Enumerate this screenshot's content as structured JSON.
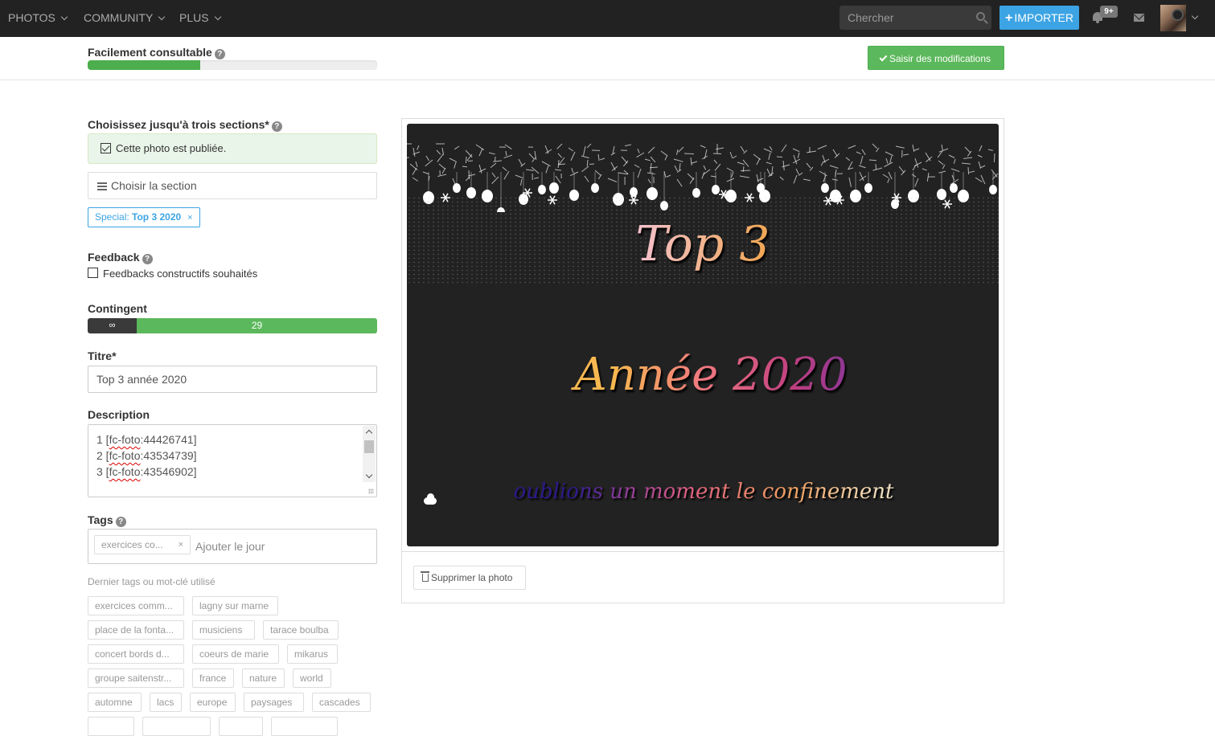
{
  "nav": {
    "items": [
      {
        "label": "PHOTOS"
      },
      {
        "label": "COMMUNITY"
      },
      {
        "label": "PLUS"
      }
    ],
    "search_placeholder": "Chercher",
    "import_label": "IMPORTER",
    "notifications_badge": "9+"
  },
  "subheader": {
    "quality_label": "Facilement consultable",
    "quality_progress_percent": 39,
    "save_label": "Saisir des modifications"
  },
  "form": {
    "sections_label": "Choisissez jusqu'à trois sections*",
    "published_text": "Cette photo est publiée.",
    "published_checked": true,
    "choose_section_label": "Choisir la section",
    "selected_section": {
      "prefix": "Special: ",
      "name": "Top 3 2020",
      "remove": "×"
    },
    "feedback_label": "Feedback",
    "feedback_checkbox_label": "Feedbacks constructifs souhaités",
    "feedback_checked": false,
    "contingent_label": "Contingent",
    "contingent_unlimited": "∞",
    "contingent_value": "29",
    "title_label": "Titre*",
    "title_value": "Top 3 année 2020",
    "description_label": "Description",
    "description_lines": [
      {
        "num": "1 [",
        "tag": "fc-foto",
        "rest": ":44426741]"
      },
      {
        "num": "2 [",
        "tag": "fc-foto",
        "rest": ":43534739]"
      },
      {
        "num": "3 [",
        "tag": "fc-foto",
        "rest": ":43546902]"
      }
    ],
    "tags_label": "Tags",
    "current_tags": [
      {
        "label": "exercices co...",
        "remove": "×"
      }
    ],
    "tags_placeholder": "Ajouter le jour",
    "recent_tags_label": "Dernier tags ou mot-clé utilisé",
    "recent_tags": [
      "exercices comm...",
      "lagny sur marne",
      "place de la fonta...",
      "musiciens",
      "tarace boulba",
      "concert bords d...",
      "coeurs de marie",
      "mikarus",
      "groupe saitenstr...",
      "france",
      "nature",
      "world",
      "automne",
      "lacs",
      "europe",
      "paysages",
      "cascades",
      "",
      "",
      "",
      ""
    ]
  },
  "photo": {
    "line1": "Top 3",
    "line2": "Année 2020",
    "line3": "oublions un moment le confinement",
    "delete_label": "Supprimer la photo"
  }
}
